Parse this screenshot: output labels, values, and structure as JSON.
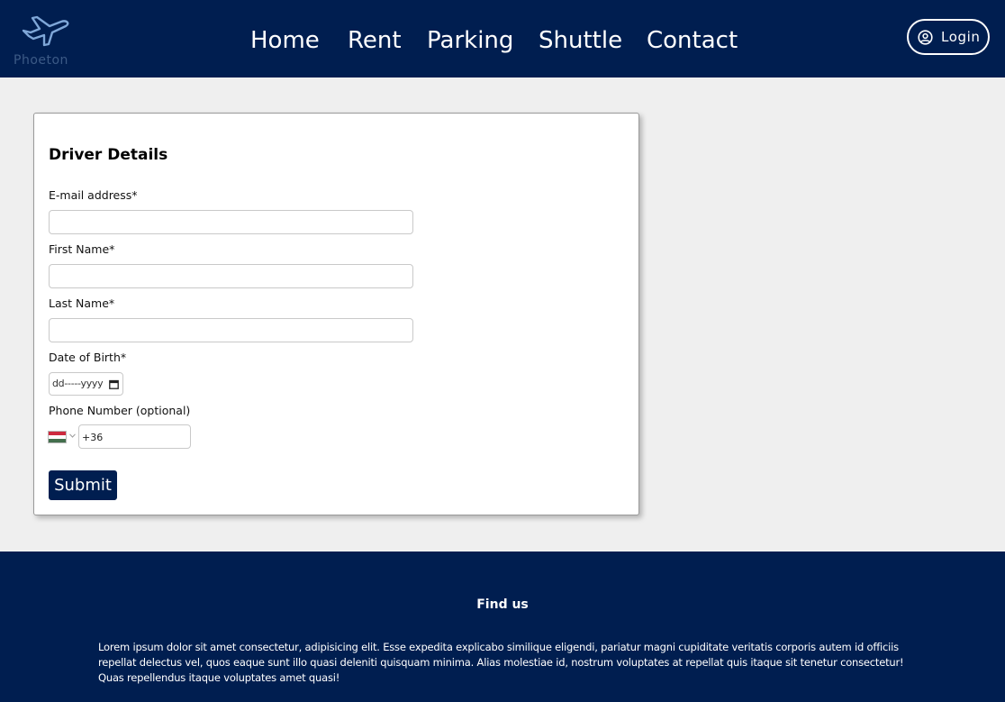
{
  "header": {
    "logo_text": "Phoeton",
    "logo_icon": "airplane-icon",
    "nav": [
      {
        "label": "Home"
      },
      {
        "label": "Rent"
      },
      {
        "label": "Parking"
      },
      {
        "label": "Shuttle"
      },
      {
        "label": "Contact"
      }
    ],
    "login_label": "Login",
    "login_icon": "user-circle-icon"
  },
  "form": {
    "title": "Driver Details",
    "email_label": "E-mail address*",
    "email_value": "",
    "first_name_label": "First Name*",
    "first_name_value": "",
    "last_name_label": "Last Name*",
    "last_name_value": "",
    "dob_label": "Date of Birth*",
    "dob_placeholder": "dd-----yyyy",
    "phone_label": "Phone Number (optional)",
    "phone_country": "Hungary",
    "phone_value": "+36",
    "submit_label": "Submit"
  },
  "footer": {
    "title": "Find us",
    "text": "Lorem ipsum dolor sit amet consectetur, adipisicing elit. Esse expedita explicabo similique eligendi, pariatur magni cupiditate veritatis corporis autem id officiis repellat delectus vel, quos eaque sunt illo quasi deleniti quisquam minima. Alias molestiae id, nostrum voluptates at repellat quis itaque sit tenetur consectetur! Quas repellendus itaque voluptates amet quasi!"
  },
  "colors": {
    "brand_navy": "#001e50",
    "page_bg": "#efefef",
    "card_bg": "#ffffff"
  }
}
